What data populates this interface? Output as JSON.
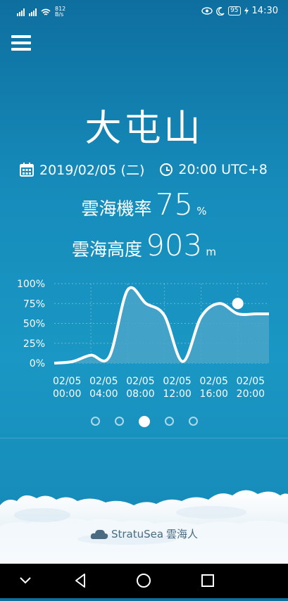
{
  "status_bar": {
    "network_speed_value": "812",
    "network_speed_unit": "B/s",
    "battery": "95",
    "time": "14:30"
  },
  "header": {
    "location_title": "大屯山"
  },
  "forecast": {
    "date": "2019/02/05 (二)",
    "time": "20:00 UTC+8",
    "probability_label": "雲海機率",
    "probability_value": "75",
    "probability_unit": "%",
    "height_label": "雲海高度",
    "height_value": "903",
    "height_unit": "m"
  },
  "chart_data": {
    "type": "area",
    "title": "",
    "xlabel": "",
    "ylabel": "",
    "ylim": [
      0,
      100
    ],
    "y_ticks": [
      "100%",
      "75%",
      "50%",
      "25%",
      "0%"
    ],
    "x_hours": [
      0,
      2,
      4,
      6,
      8,
      10,
      12,
      14,
      16,
      18,
      20,
      22
    ],
    "categories": [
      "02/05\n00:00",
      "02/05\n04:00",
      "02/05\n08:00",
      "02/05\n12:00",
      "02/05\n16:00",
      "02/05\n20:00"
    ],
    "series": [
      {
        "values": [
          0,
          2,
          10,
          8,
          92,
          75,
          60,
          2,
          58,
          75,
          62,
          62
        ]
      }
    ],
    "highlight_point": {
      "hour": 20,
      "value": 75
    },
    "grid": true
  },
  "pager": {
    "count": 5,
    "active": 2
  },
  "footer": {
    "brand_name": "StratuSea",
    "brand_cjk": "雲海人"
  },
  "colors": {
    "background": "#1a8fbf",
    "area_fill": "#4aa4c8"
  }
}
